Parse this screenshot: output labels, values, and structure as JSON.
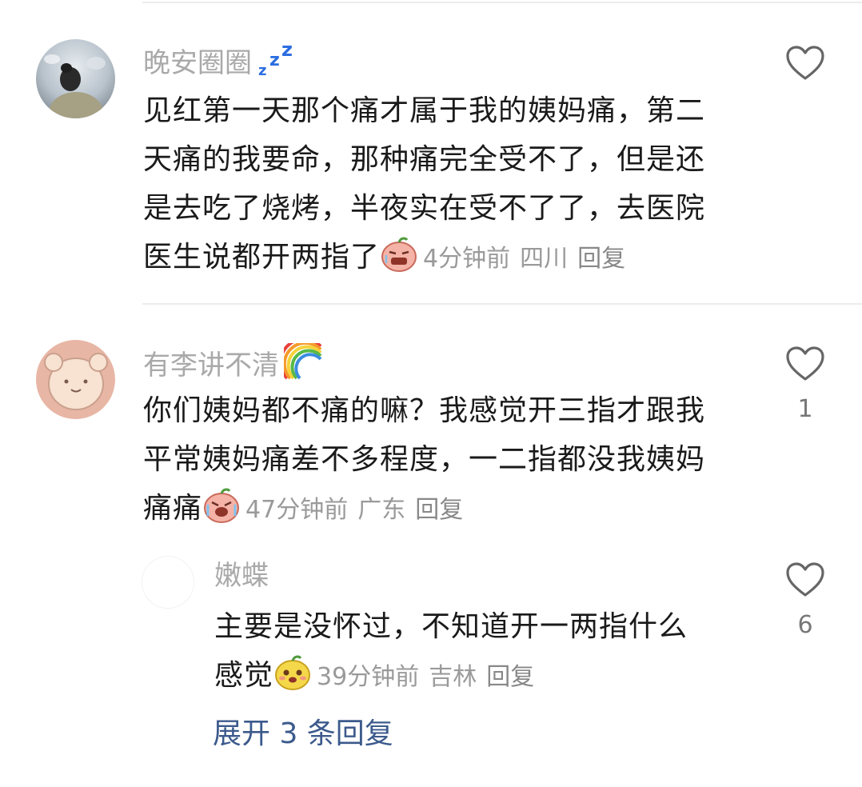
{
  "comments": [
    {
      "username": "晚安圈圈",
      "username_emoji": "zzz-icon",
      "lines": [
        "见红第一天那个痛才属于我的姨妈痛，第二",
        "天痛的我要命，那种痛完全受不了，但是还",
        "是去吃了烧烤，半夜实在受不了了，去医院",
        "医生说都开两指了"
      ],
      "time": "4分钟前",
      "location": "四川",
      "reply": "回复",
      "likes": ""
    },
    {
      "username": "有李讲不清",
      "username_emoji": "rainbow-icon",
      "lines": [
        "你们姨妈都不痛的嘛？我感觉开三指才跟我",
        "平常姨妈痛差不多程度，一二指都没我姨妈",
        "痛痛"
      ],
      "time": "47分钟前",
      "location": "广东",
      "reply": "回复",
      "likes": "1"
    },
    {
      "username": "嫩蝶",
      "username_emoji": "",
      "lines": [
        "主要是没怀过，不知道开一两指什么",
        "感觉"
      ],
      "time": "39分钟前",
      "location": "吉林",
      "reply": "回复",
      "likes": "6"
    }
  ],
  "expand_replies": "展开 3 条回复",
  "colors": {
    "username": "#a9a9a9",
    "body": "#1a1a1a",
    "meta": "#9a9a9a",
    "link": "#3c5a8c",
    "divider": "#ececec"
  }
}
